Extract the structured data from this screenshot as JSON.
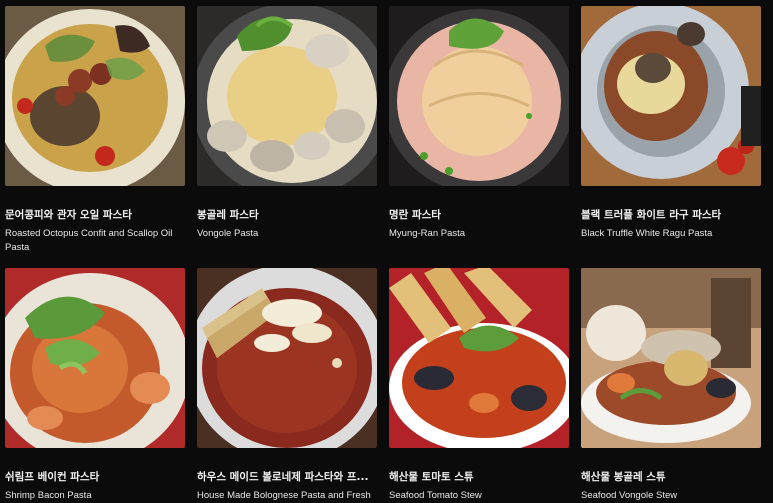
{
  "menu": {
    "items": [
      {
        "ko": "문어콩피와 관자 오일 파스타",
        "en": "Roasted Octopus Confit and Scallop Oil Pasta"
      },
      {
        "ko": "봉골레 파스타",
        "en": "Vongole Pasta"
      },
      {
        "ko": "명란 파스타",
        "en": "Myung-Ran Pasta"
      },
      {
        "ko": "블랙 트러플 화이트 라구 파스타",
        "en": "Black Truffle White Ragu Pasta"
      },
      {
        "ko": "쉬림프 베이컨 파스타",
        "en": "Shrimp Bacon Pasta"
      },
      {
        "ko": "하우스 메이드 볼로네제 파스타와 프...",
        "en": "House Made Bolognese Pasta and Fresh"
      },
      {
        "ko": "해산물 토마토 스튜",
        "en": "Seafood Tomato Stew"
      },
      {
        "ko": "해산물 봉골레 스튜",
        "en": "Seafood Vongole Stew"
      }
    ]
  }
}
